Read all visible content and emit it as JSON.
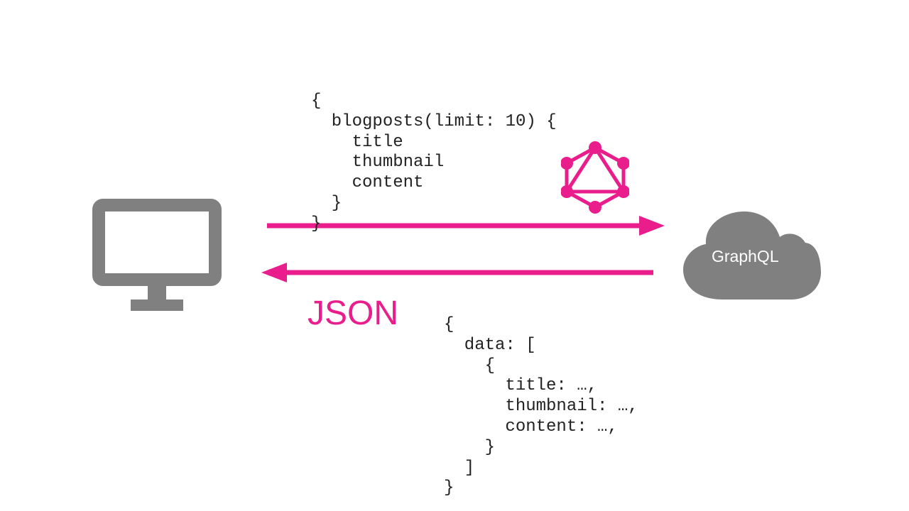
{
  "colors": {
    "magenta": "#e91e8c",
    "gray": "#808080",
    "white": "#ffffff"
  },
  "client": {
    "label": "client computer"
  },
  "server": {
    "label": "GraphQL"
  },
  "query_code": "{\n  blogposts(limit: 10) {\n    title\n    thumbnail\n    content\n  }\n}",
  "response_label": "JSON",
  "response_code": "{\n  data: [\n    {\n      title: …,\n      thumbnail: …,\n      content: …,\n    }\n  ]\n}"
}
